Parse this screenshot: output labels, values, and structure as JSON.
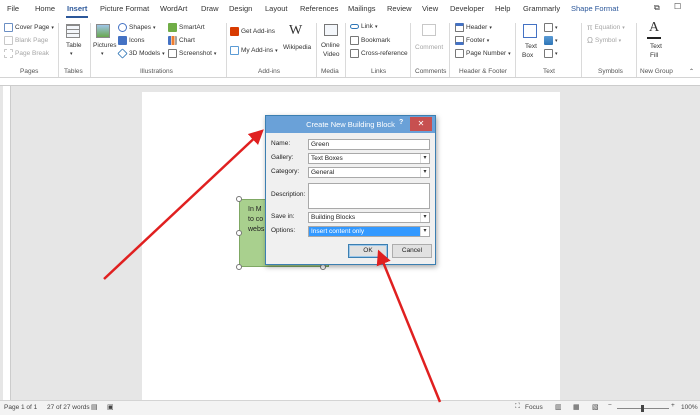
{
  "tabs": [
    "File",
    "Home",
    "Insert",
    "Picture Format",
    "WordArt",
    "Draw",
    "Design",
    "Layout",
    "References",
    "Mailings",
    "Review",
    "View",
    "Developer",
    "Help",
    "Grammarly",
    "Shape Format"
  ],
  "active_tab": "Insert",
  "ribbon": {
    "pages": {
      "cover_page": "Cover Page",
      "blank_page": "Blank Page",
      "page_break": "Page Break",
      "group": "Pages"
    },
    "tables": {
      "table": "Table",
      "group": "Tables"
    },
    "illustrations": {
      "pictures": "Pictures",
      "shapes": "Shapes",
      "icons": "Icons",
      "models3d": "3D Models",
      "smartart": "SmartArt",
      "chart": "Chart",
      "screenshot": "Screenshot",
      "group": "Illustrations"
    },
    "addins": {
      "get_addins": "Get Add-ins",
      "my_addins": "My Add-ins",
      "wikipedia": "Wikipedia",
      "group": "Add-ins"
    },
    "media": {
      "online_video_1": "Online",
      "online_video_2": "Video",
      "group": "Media"
    },
    "links": {
      "link": "Link",
      "bookmark": "Bookmark",
      "cross_reference": "Cross-reference",
      "group": "Links"
    },
    "comments": {
      "comment": "Comment",
      "group": "Comments"
    },
    "header_footer": {
      "header": "Header",
      "footer": "Footer",
      "page_number": "Page Number",
      "group": "Header & Footer"
    },
    "text": {
      "text_box_1": "Text",
      "text_box_2": "Box",
      "group": "Text"
    },
    "symbols": {
      "equation": "Equation",
      "symbol": "Symbol",
      "group": "Symbols"
    },
    "new_group": {
      "text_fill_1": "Text",
      "text_fill_2": "Fill",
      "group": "New Group"
    }
  },
  "textbox_lines": [
    "In M",
    "to co",
    "webs"
  ],
  "dialog": {
    "title": "Create New Building Block",
    "help": "?",
    "close": "✕",
    "name_label": "Name:",
    "name_value": "Green",
    "gallery_label": "Gallery:",
    "gallery_value": "Text Boxes",
    "category_label": "Category:",
    "category_value": "General",
    "description_label": "Description:",
    "description_value": "",
    "save_in_label": "Save in:",
    "save_in_value": "Building Blocks",
    "options_label": "Options:",
    "options_value": "Insert content only",
    "ok": "OK",
    "cancel": "Cancel"
  },
  "status": {
    "page": "Page 1 of 1",
    "words": "27 of 27 words",
    "focus": "Focus",
    "zoom": "100%"
  },
  "colors": {
    "accent": "#2b579a",
    "titlebar": "#6aa1d8",
    "textbox": "#a9d08e",
    "arrow": "#e02020"
  }
}
